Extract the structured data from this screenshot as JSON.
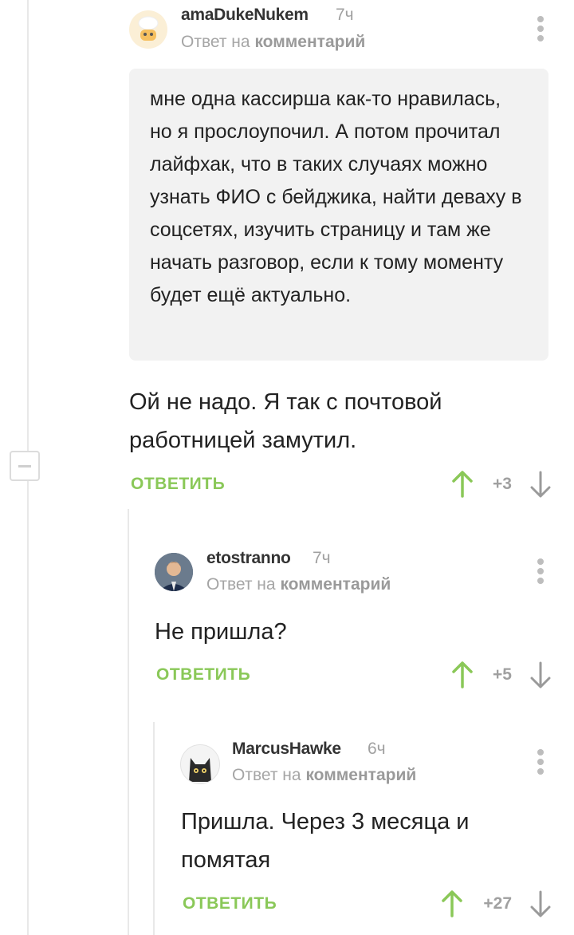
{
  "comments": [
    {
      "username": "amaDukeNukem",
      "time": "7ч",
      "reply_prefix": "Ответ на",
      "reply_link": "комментарий",
      "quote": "мне одна кассирша как-то нравилась, но я прослоупочил. А потом прочитал лайфхак, что в таких случаях можно узнать ФИО с бейджика, найти деваху в соцсетях, изучить страницу и там же начать разговор, если к тому моменту будет ещё актуально.",
      "text": "Ой не надо. Я так с почтовой работницей замутил.",
      "reply_label": "ОТВЕТИТЬ",
      "score": "+3"
    },
    {
      "username": "etostranno",
      "time": "7ч",
      "reply_prefix": "Ответ на",
      "reply_link": "комментарий",
      "text": "Не пришла?",
      "reply_label": "ОТВЕТИТЬ",
      "score": "+5"
    },
    {
      "username": "MarcusHawke",
      "time": "6ч",
      "reply_prefix": "Ответ на",
      "reply_link": "комментарий",
      "text": "Пришла. Через 3 месяца и помятая",
      "reply_label": "ОТВЕТИТЬ",
      "score": "+27"
    }
  ],
  "colors": {
    "accent_green": "#8ac858",
    "muted_gray": "#a0a0a0",
    "quote_bg": "#f2f2f2",
    "thread_line": "#e8e8e8"
  },
  "icons": [
    "collapse-thread-icon",
    "more-options-icon",
    "upvote-arrow-icon",
    "downvote-arrow-icon"
  ]
}
